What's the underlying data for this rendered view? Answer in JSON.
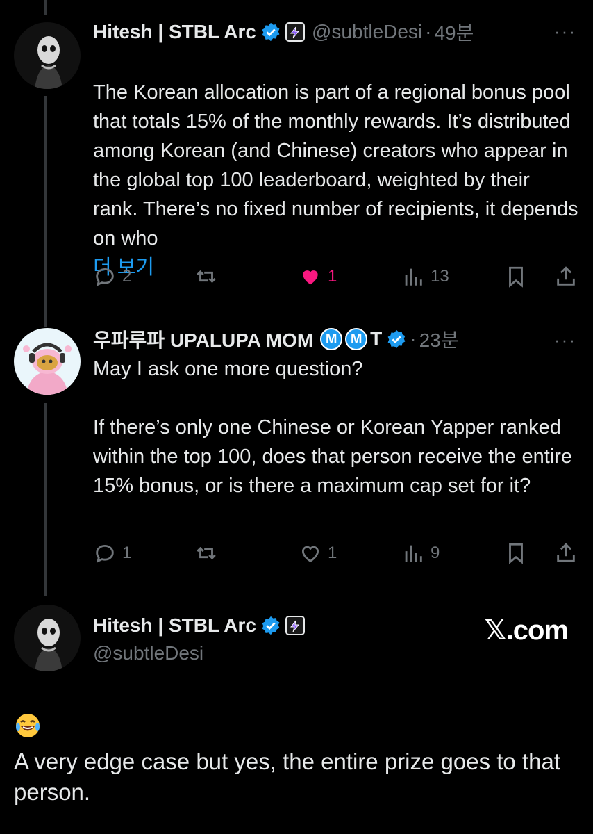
{
  "tweets": [
    {
      "name": "Hitesh | STBL Arc",
      "handle": "@subtleDesi",
      "dot": "·",
      "time": "49분",
      "text": "The Korean allocation is part of a regional bonus pool that totals 15% of the monthly rewards. It’s distributed among Korean (and Chinese) creators who appear in the global top 100 leaderboard, weighted by their rank. There’s no fixed number of recipients, it depends on who",
      "show_more": "더 보기",
      "replies": "2",
      "retweets": "",
      "likes": "1",
      "liked": true,
      "views": "13"
    },
    {
      "name": "우파루파 UPALUPA MOM",
      "badge_m1": "M",
      "badge_m2": "M",
      "name_suffix": "T",
      "dot": "·",
      "time": "23분",
      "text": "May I ask one more question?\n\nIf there’s only one Chinese or Korean Yapper ranked within the top 100, does that person receive the entire 15% bonus, or is there a maximum cap set for it?",
      "replies": "1",
      "retweets": "",
      "likes": "1",
      "liked": false,
      "views": "9"
    }
  ],
  "main_tweet": {
    "name": "Hitesh | STBL Arc",
    "handle": "@subtleDesi",
    "watermark": "𝕏.com",
    "emoji": "😂",
    "text": "A very edge case but yes, the entire prize goes to that person."
  },
  "more_icon": "···",
  "colors": {
    "background": "#000000",
    "text": "#e7e9ea",
    "muted": "#71767b",
    "accent": "#1d9bf0",
    "like": "#f91880"
  },
  "icons": [
    "reply-icon",
    "retweet-icon",
    "heart-icon",
    "views-icon",
    "bookmark-icon",
    "share-icon",
    "verified-icon",
    "affiliate-icon",
    "more-icon"
  ]
}
